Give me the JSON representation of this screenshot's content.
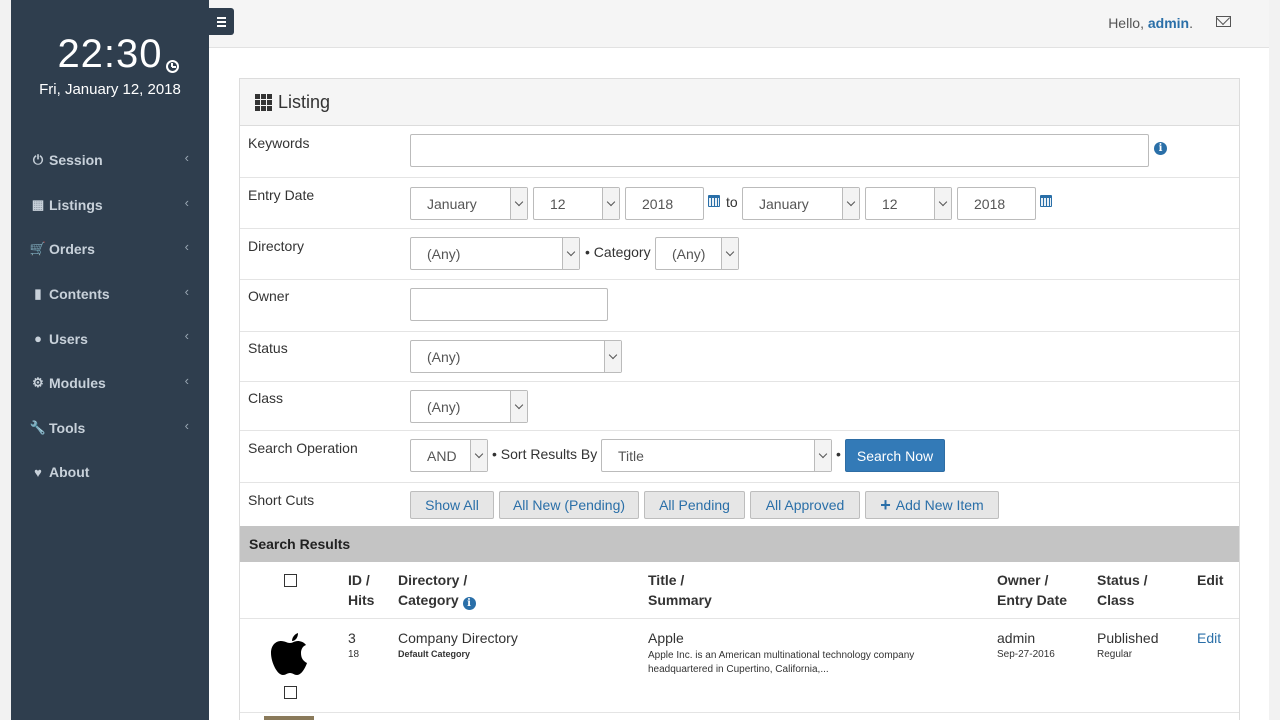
{
  "sidebar": {
    "time": "22:30",
    "date": "Fri, January 12, 2018",
    "items": [
      {
        "label": "Session",
        "icon": "power-icon"
      },
      {
        "label": "Listings",
        "icon": "grid-icon"
      },
      {
        "label": "Orders",
        "icon": "cart-icon"
      },
      {
        "label": "Contents",
        "icon": "file-icon"
      },
      {
        "label": "Users",
        "icon": "user-icon"
      },
      {
        "label": "Modules",
        "icon": "gear-icon"
      },
      {
        "label": "Tools",
        "icon": "wrench-icon"
      },
      {
        "label": "About",
        "icon": "heart-icon"
      }
    ]
  },
  "topbar": {
    "hello_prefix": "Hello,",
    "username": "admin",
    "hello_suffix": "."
  },
  "panel": {
    "title": "Listing"
  },
  "form": {
    "keywords": {
      "label": "Keywords",
      "value": ""
    },
    "entry_date": {
      "label": "Entry Date",
      "from_month": "January",
      "from_day": "12",
      "from_year": "2018",
      "to_text": "to",
      "to_month": "January",
      "to_day": "12",
      "to_year": "2018"
    },
    "directory": {
      "label": "Directory",
      "value": "(Any)",
      "category_label": "• Category",
      "category_value": "(Any)"
    },
    "owner": {
      "label": "Owner",
      "value": ""
    },
    "status": {
      "label": "Status",
      "value": "(Any)"
    },
    "class": {
      "label": "Class",
      "value": "(Any)"
    },
    "search_operation": {
      "label": "Search Operation",
      "value": "AND",
      "sort_label": "• Sort Results By",
      "sort_value": "Title",
      "dot": "•",
      "search_button": "Search Now"
    },
    "short_cuts": {
      "label": "Short Cuts",
      "buttons": [
        "Show All",
        "All New (Pending)",
        "All Pending",
        "All Approved"
      ],
      "add_new": "Add New Item"
    }
  },
  "results": {
    "title": "Search Results",
    "headers": {
      "id": [
        "ID /",
        "Hits"
      ],
      "directory": [
        "Directory /",
        "Category"
      ],
      "title": [
        "Title /",
        "Summary"
      ],
      "owner": [
        "Owner /",
        "Entry Date"
      ],
      "status": [
        "Status /",
        "Class"
      ],
      "edit": "Edit"
    },
    "rows": [
      {
        "id": "3",
        "hits": "18",
        "directory": "Company Directory",
        "category": "Default Category",
        "title": "Apple",
        "summary_line1": "Apple Inc. is an American multinational technology company",
        "summary_line2": "headquartered in Cupertino, California,...",
        "owner": "admin",
        "entry_date": "Sep-27-2016",
        "status": "Published",
        "class": "Regular",
        "edit": "Edit"
      }
    ]
  }
}
